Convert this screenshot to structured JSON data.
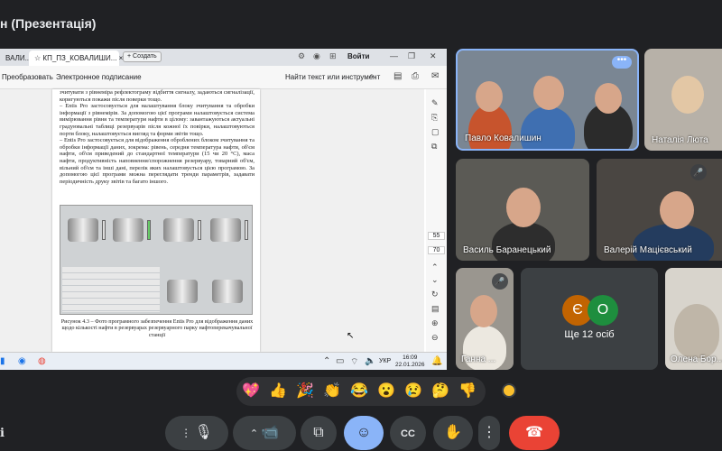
{
  "meeting": {
    "title": "н (Презентація)"
  },
  "browser": {
    "tabs": [
      "ВАЛИ...",
      "КП_ПЗ_КОВАЛИШИ...",
      "+ Создать"
    ],
    "tab_close": "×",
    "signin": "Войти",
    "window_controls": [
      "—",
      "❐",
      "✕"
    ],
    "toolbar": {
      "convert": "Преобразовать",
      "sign": "Электронное подписание",
      "search_placeholder": "Найти текст или инструмент"
    }
  },
  "document": {
    "paragraphs": [
      "зчитувати з рівнеміра рефлектограму відбиття сигналу, задаються сигналізації, коригуються покажи після поверки тощо.",
      "– Entis Pro застосовується для налаштування блоку зчитування та обробки інформації з рівнемірів. За допомогою цієї програми налаштовується система вимірювання рівня та температури нафти в цілому: завантажуються актуальні градуювальні таблиці резервуарів після кожної їх повірки, налаштовуються порти блоку, налаштовується вигляд та форми звітів тощо.",
      "– Entis Pro застосовується для відображення оброблених блоком зчитування та обробки інформації даних, зокрема: рівень, середня температура нафти, об'єм нафти, об'єм приведений до стандартної температури (15 чи 20 °С), маса нафти, продуктивність наповнення/спорожнення резервуару, товарний об'єм, вільний об'єм та інші дані, перелік яких налаштовується цією програмою. За допомогою цієї програми можна переглядати тренди параметрів, задавати періодичність друку звітів та багато іншого."
    ],
    "caption": "Рисунок 4.3 – Фото програмного забезпечення Entis Pro для відображення даних щодо кількості нафти в резервуарах резервуарного парку нафтоперекачувальної станції"
  },
  "sidepanel": {
    "page_current": "55",
    "page_total": "70"
  },
  "taskbar": {
    "lang": "УКР",
    "time": "16:09",
    "date": "22.01.2026"
  },
  "participants": [
    {
      "name": "Павло Ковалишин"
    },
    {
      "name": "Наталія Люта"
    },
    {
      "name": "Василь Баранецький"
    },
    {
      "name": "Валерій Мацієвський"
    },
    {
      "name": "Ганна ..."
    },
    {
      "name": "Олена Бор..."
    }
  ],
  "others": {
    "initials": [
      "Є",
      "О"
    ],
    "colors": [
      "#c26401",
      "#1e8e3e"
    ],
    "label": "Ще 12 осіб"
  },
  "reactions": [
    "💖",
    "👍",
    "🎉",
    "👏",
    "😂",
    "😮",
    "😢",
    "🤔",
    "👎"
  ],
  "colors": {
    "accent": "#8ab4f8",
    "end_call": "#ea4335",
    "background": "#202124"
  }
}
